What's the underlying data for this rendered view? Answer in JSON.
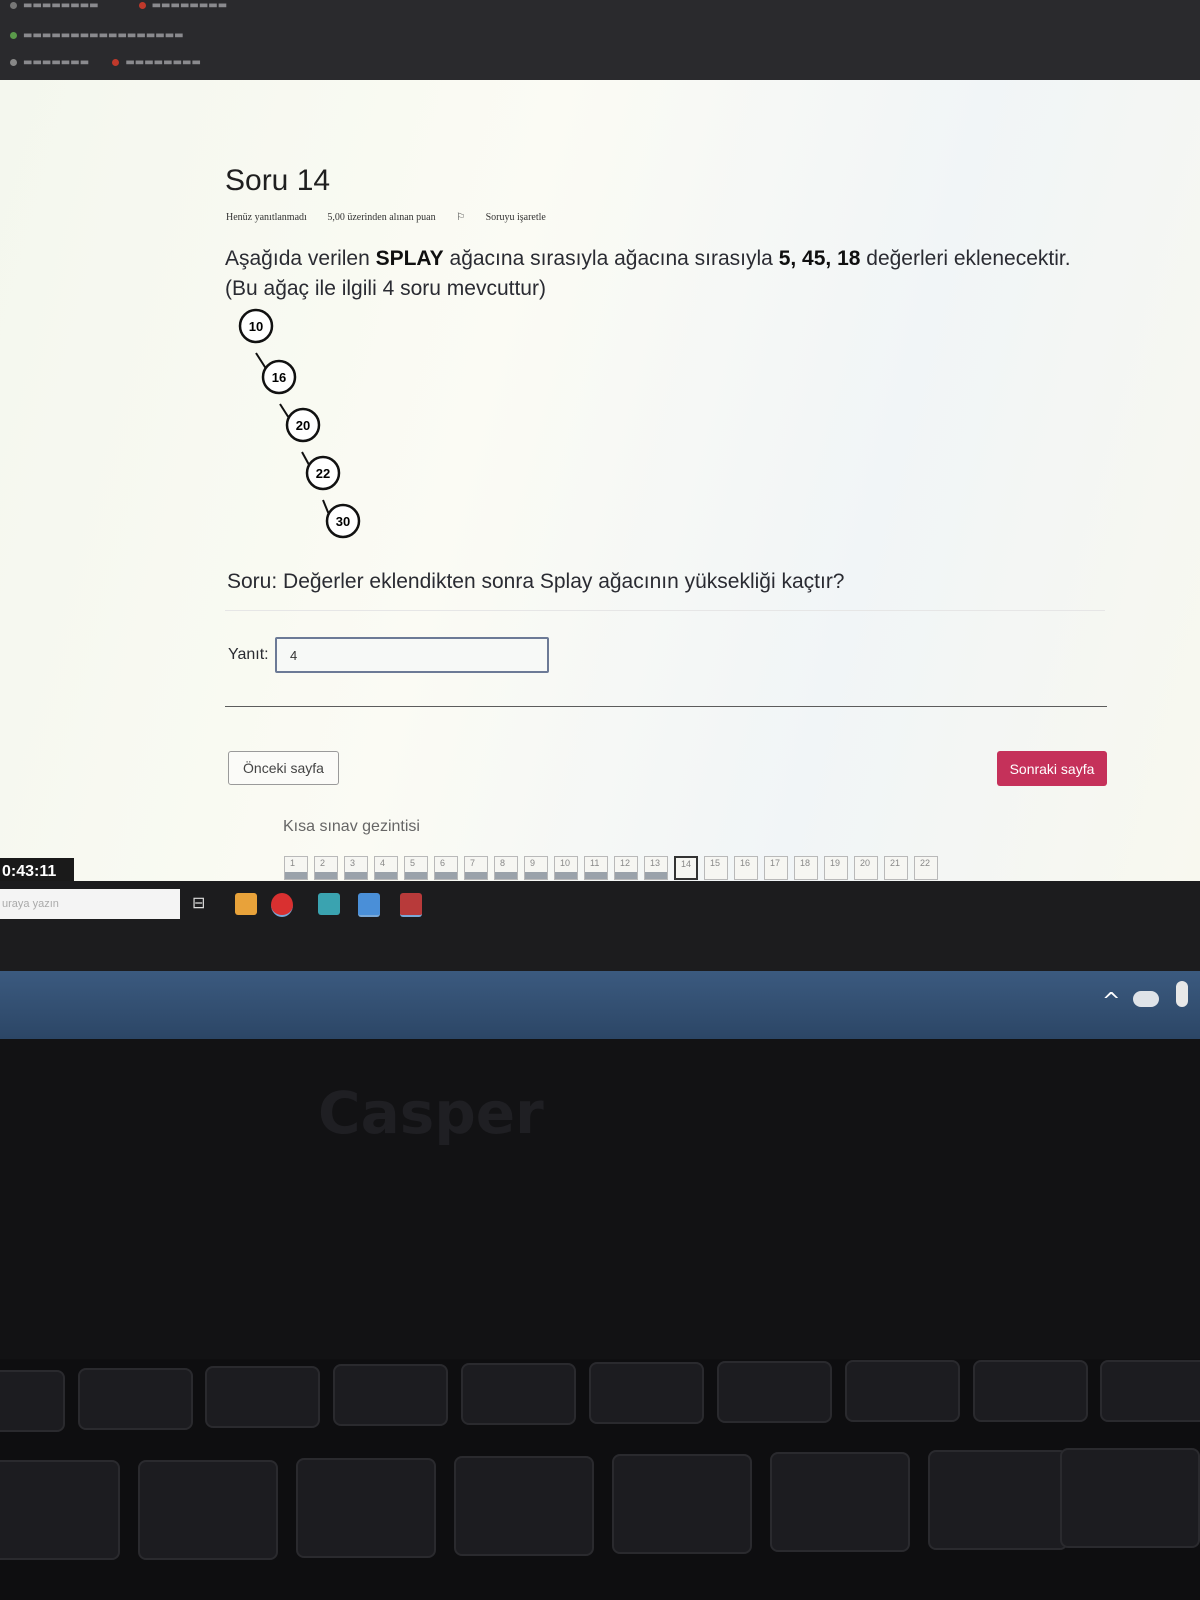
{
  "browser": {
    "tabs_row": [
      "",
      ""
    ],
    "address_text": "",
    "bookmarks_row": ""
  },
  "question": {
    "title": "Soru 14",
    "status": "Henüz yanıtlanmadı",
    "points": "5,00 üzerinden alınan puan",
    "flag": "Soruyu işaretle",
    "prompt_before": "Aşağıda verilen ",
    "prompt_bold": "SPLAY",
    "prompt_after": " ağacına sırasıyla ağacına sırasıyla ",
    "prompt_values": "5, 45, 18",
    "prompt_end": " değerleri eklenecektir.",
    "prompt_note": "(Bu ağaç ile ilgili 4 soru mevcuttur)",
    "tree_nodes": [
      "10",
      "16",
      "20",
      "22",
      "30"
    ],
    "question_text": "Soru: Değerler eklendikten sonra Splay ağacının yüksekliği kaçtır?",
    "answer_label": "Yanıt:",
    "answer_value": "4"
  },
  "navigation": {
    "prev_label": "Önceki sayfa",
    "next_label": "Sonraki sayfa",
    "nav_title": "Kısa sınav gezintisi",
    "pages": [
      "1",
      "2",
      "3",
      "4",
      "5",
      "6",
      "7",
      "8",
      "9",
      "10",
      "11",
      "12",
      "13",
      "14",
      "15",
      "16",
      "17",
      "18",
      "19",
      "20",
      "21",
      "22"
    ],
    "answered_through": 13,
    "current_page": "14"
  },
  "taskbar": {
    "clock": "0:43:11",
    "search_placeholder": "uraya yazın"
  },
  "colors": {
    "next_button": "#c5315a",
    "system_tray": "#3b5a7f"
  },
  "hardware": {
    "brand": "Casper"
  }
}
